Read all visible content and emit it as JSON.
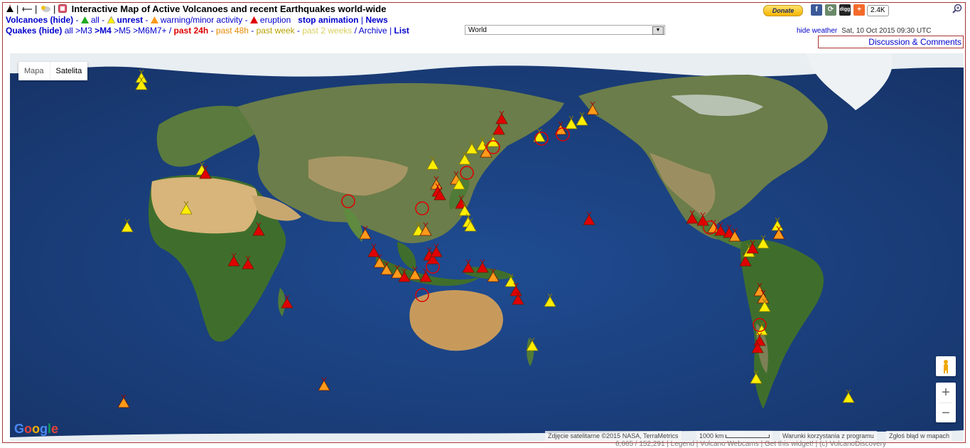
{
  "header": {
    "title": "Interactive Map of Active Volcanoes and recent Earthquakes world-wide",
    "volcanoes": {
      "label": "Volcanoes (hide)",
      "all": "all",
      "unrest": "unrest",
      "warning": "warning/minor activity",
      "eruption": "eruption",
      "stop": "stop animation",
      "news": "News"
    },
    "quakes": {
      "label": "Quakes (hide)",
      "all": "all",
      "m3": ">M3",
      "m4": ">M4",
      "m5": ">M5",
      "m6": ">M6",
      "m7": "M7+",
      "p24": "past 24h",
      "p48": "past 48h",
      "pweek": "past week",
      "p2w": "past 2 weeks",
      "archive": "Archive",
      "list": "List"
    },
    "region_select": "World",
    "donate": "Donate",
    "share_count": "2.4K",
    "hide_weather": "hide weather",
    "datetime": "Sat, 10 Oct 2015 09:30 UTC",
    "discussion": "Discussion & Comments"
  },
  "map": {
    "maptype": [
      "Mapa",
      "Satelita"
    ],
    "zoom_in": "+",
    "zoom_out": "−",
    "attribution": "Zdjęcie satelitarne ©2015 NASA, TerraMetrics",
    "scale": "1000 km",
    "terms": "Warunki korzystania z programu",
    "report": "Zgłoś błąd w mapach",
    "google": "Google"
  },
  "footer": "6,665 / 152,291 | Legend | Volcano Webcams | Get this widget! | (c) VolcanoDiscovery",
  "colors": {
    "unrest": "#ffee00",
    "warning": "#ff9a1a",
    "eruption": "#e00000",
    "quake": "#e00000",
    "ocean": "#1a3a7a"
  }
}
